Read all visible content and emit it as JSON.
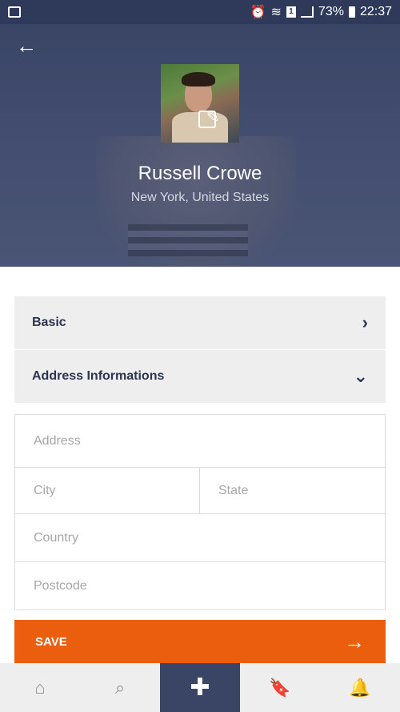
{
  "status_bar": {
    "battery": "73%",
    "time": "22:37",
    "sim_slot": "1"
  },
  "profile": {
    "name": "Russell Crowe",
    "location": "New York, United States"
  },
  "icons": {
    "back": "←",
    "edit": "✎",
    "chevron_right": "›",
    "chevron_down": "⌄",
    "save_arrow": "→",
    "home": "⌂",
    "search": "⌕",
    "add": "✚",
    "bookmark": "🔖",
    "bell": "🔔"
  },
  "sections": {
    "basic_label": "Basic",
    "address_label": "Address Informations"
  },
  "form": {
    "address_placeholder": "Address",
    "city_placeholder": "City",
    "state_placeholder": "State",
    "country_placeholder": "Country",
    "postcode_placeholder": "Postcode"
  },
  "actions": {
    "save_label": "SAVE"
  },
  "colors": {
    "header": "#3a4566",
    "accent": "#ea5e0e",
    "nav_active": "#3a4566"
  }
}
